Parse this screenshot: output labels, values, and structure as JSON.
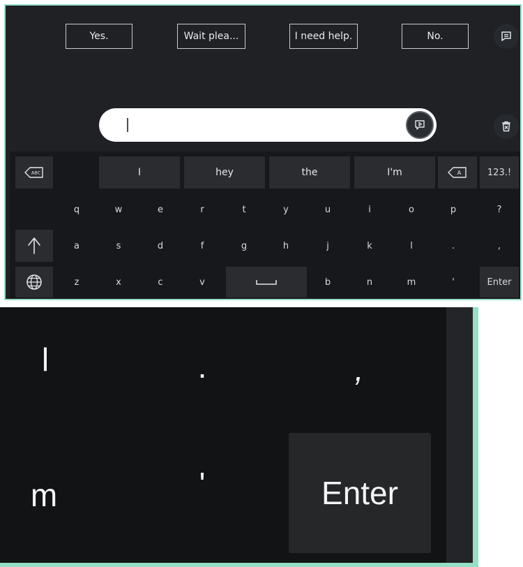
{
  "phrases": [
    "Yes.",
    "Wait plea...",
    "I need help.",
    "No."
  ],
  "suggestions": [
    "I",
    "hey",
    "the",
    "I'm"
  ],
  "keys": {
    "row1": [
      "q",
      "w",
      "e",
      "r",
      "t",
      "y",
      "u",
      "i",
      "o",
      "p",
      "?"
    ],
    "row2": [
      "a",
      "s",
      "d",
      "f",
      "g",
      "h",
      "j",
      "k",
      "l",
      ".",
      ","
    ],
    "row3_left": [
      "z",
      "x",
      "c",
      "v"
    ],
    "row3_right": [
      "b",
      "n",
      "m",
      "'"
    ],
    "numbers_label": "123.!",
    "enter_label": "Enter",
    "abc_label": "ABC",
    "backspace_label": "A"
  },
  "zoom": {
    "row_top": [
      "l",
      ".",
      ","
    ],
    "row_bottom": [
      "m",
      "'"
    ],
    "enter_label": "Enter"
  },
  "colors": {
    "accent_border": "#95dfc6",
    "background": "#1f2125",
    "keyboard": "#17181b",
    "key": "#2a2c30"
  },
  "icons": [
    "chat-icon",
    "trash-x-icon",
    "play-message-icon",
    "abc-backspace-icon",
    "backspace-icon",
    "shift-arrow-icon",
    "globe-icon",
    "space-icon"
  ]
}
